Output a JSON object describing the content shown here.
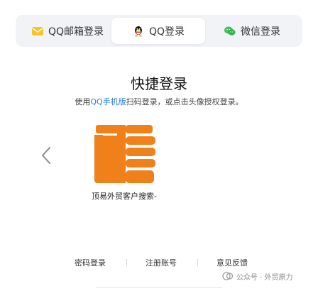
{
  "tabs": [
    {
      "label": "QQ邮箱登录",
      "icon": "mail-icon"
    },
    {
      "label": "QQ登录",
      "icon": "qq-penguin-icon",
      "active": true
    },
    {
      "label": "微信登录",
      "icon": "wechat-icon"
    }
  ],
  "main": {
    "title": "快捷登录",
    "subtitle_before": "使用",
    "subtitle_link": "QQ手机版",
    "subtitle_after": "扫码登录，或点击头像授权登录。",
    "account_name": "顶易外贸客户搜索-"
  },
  "footer": {
    "password_login": "密码登录",
    "register": "注册账号",
    "feedback": "意见反馈"
  },
  "watermark": {
    "text": "公众号 · 外贸原力"
  },
  "colors": {
    "accent_link": "#2c7be5",
    "tab_bg": "#f1f3f6",
    "avatar_orange": "#f0801a"
  }
}
